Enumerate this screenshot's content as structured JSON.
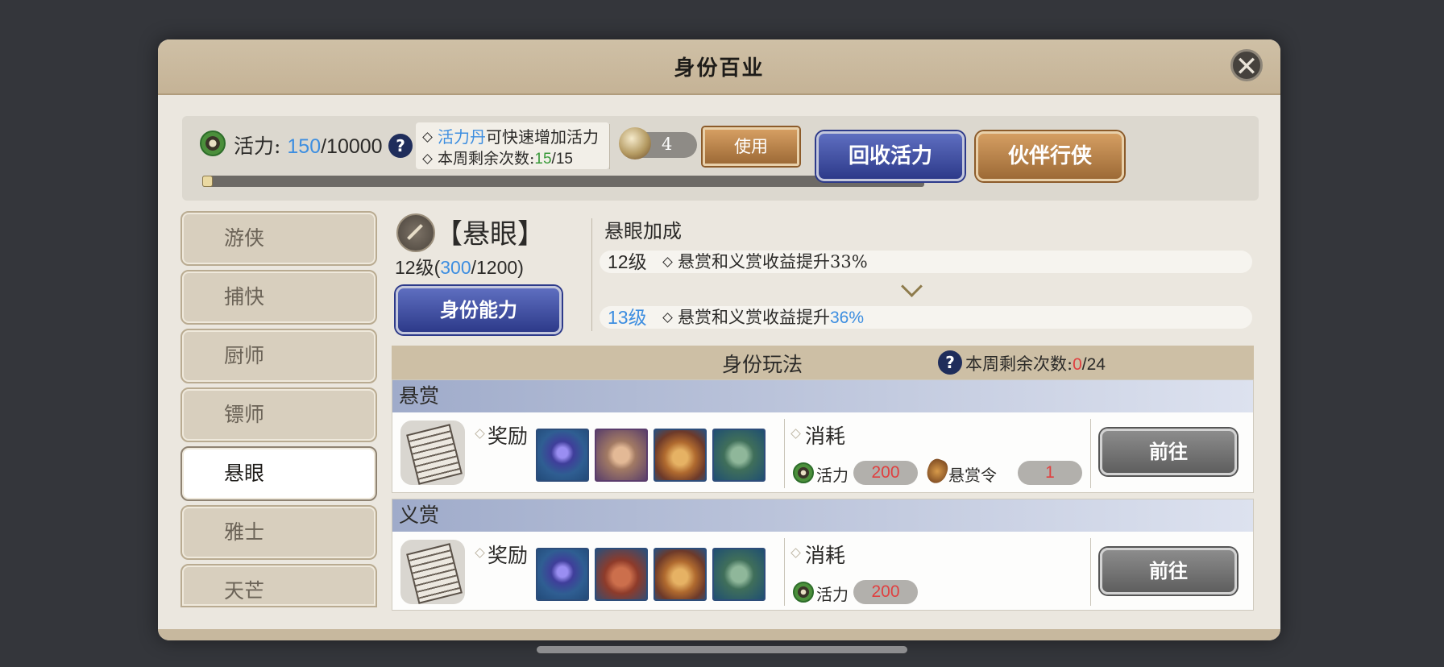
{
  "dialog": {
    "title": "身份百业",
    "close_icon": "✕"
  },
  "energy": {
    "label": "活力:",
    "current": "150",
    "max": "/10000",
    "help": "?",
    "progress": 0.015,
    "tip_pill_name": "活力丹",
    "tip_line1_rest": "可快速增加活力",
    "tip_line2_label": "本周剩余次数:",
    "tip_line2_used": "15",
    "tip_line2_total": "/15",
    "item_count": "4",
    "use_button": "使用"
  },
  "top_buttons": {
    "reclaim": "回收活力",
    "partner": "伙伴行侠"
  },
  "sidebar": {
    "items": [
      {
        "label": "游侠",
        "active": false
      },
      {
        "label": "捕快",
        "active": false
      },
      {
        "label": "厨师",
        "active": false
      },
      {
        "label": "镖师",
        "active": false
      },
      {
        "label": "悬眼",
        "active": true
      },
      {
        "label": "雅士",
        "active": false
      },
      {
        "label": "天芒",
        "active": false
      }
    ]
  },
  "identity": {
    "name": "【悬眼】",
    "level_prefix": "12级(",
    "exp": "300",
    "exp_total": "/1200",
    "level_suffix": ")",
    "ability_button": "身份能力",
    "bonus_title": "悬眼加成",
    "current_level": "12级",
    "current_bonus": "悬赏和义赏收益提升33%",
    "next_level": "13级",
    "next_bonus_text": "悬赏和义赏收益提升",
    "next_bonus_value": "36%"
  },
  "play": {
    "title": "身份玩法",
    "help": "?",
    "remaining_label": "本周剩余次数:",
    "remaining_used": "0",
    "remaining_total": "/24"
  },
  "cards": [
    {
      "name": "悬赏",
      "reward_label": "奖励",
      "cost_label": "消耗",
      "energy_cost_label": "活力",
      "energy_cost": "200",
      "token_label": "悬赏令",
      "token_cost": "1",
      "go_button": "前往"
    },
    {
      "name": "义赏",
      "reward_label": "奖励",
      "cost_label": "消耗",
      "energy_cost_label": "活力",
      "energy_cost": "200",
      "go_button": "前往"
    }
  ],
  "colors": {
    "accent_blue": "#3d8ee0",
    "green": "#3a9a3a",
    "red": "#e04040",
    "frame": "#c5b396"
  }
}
